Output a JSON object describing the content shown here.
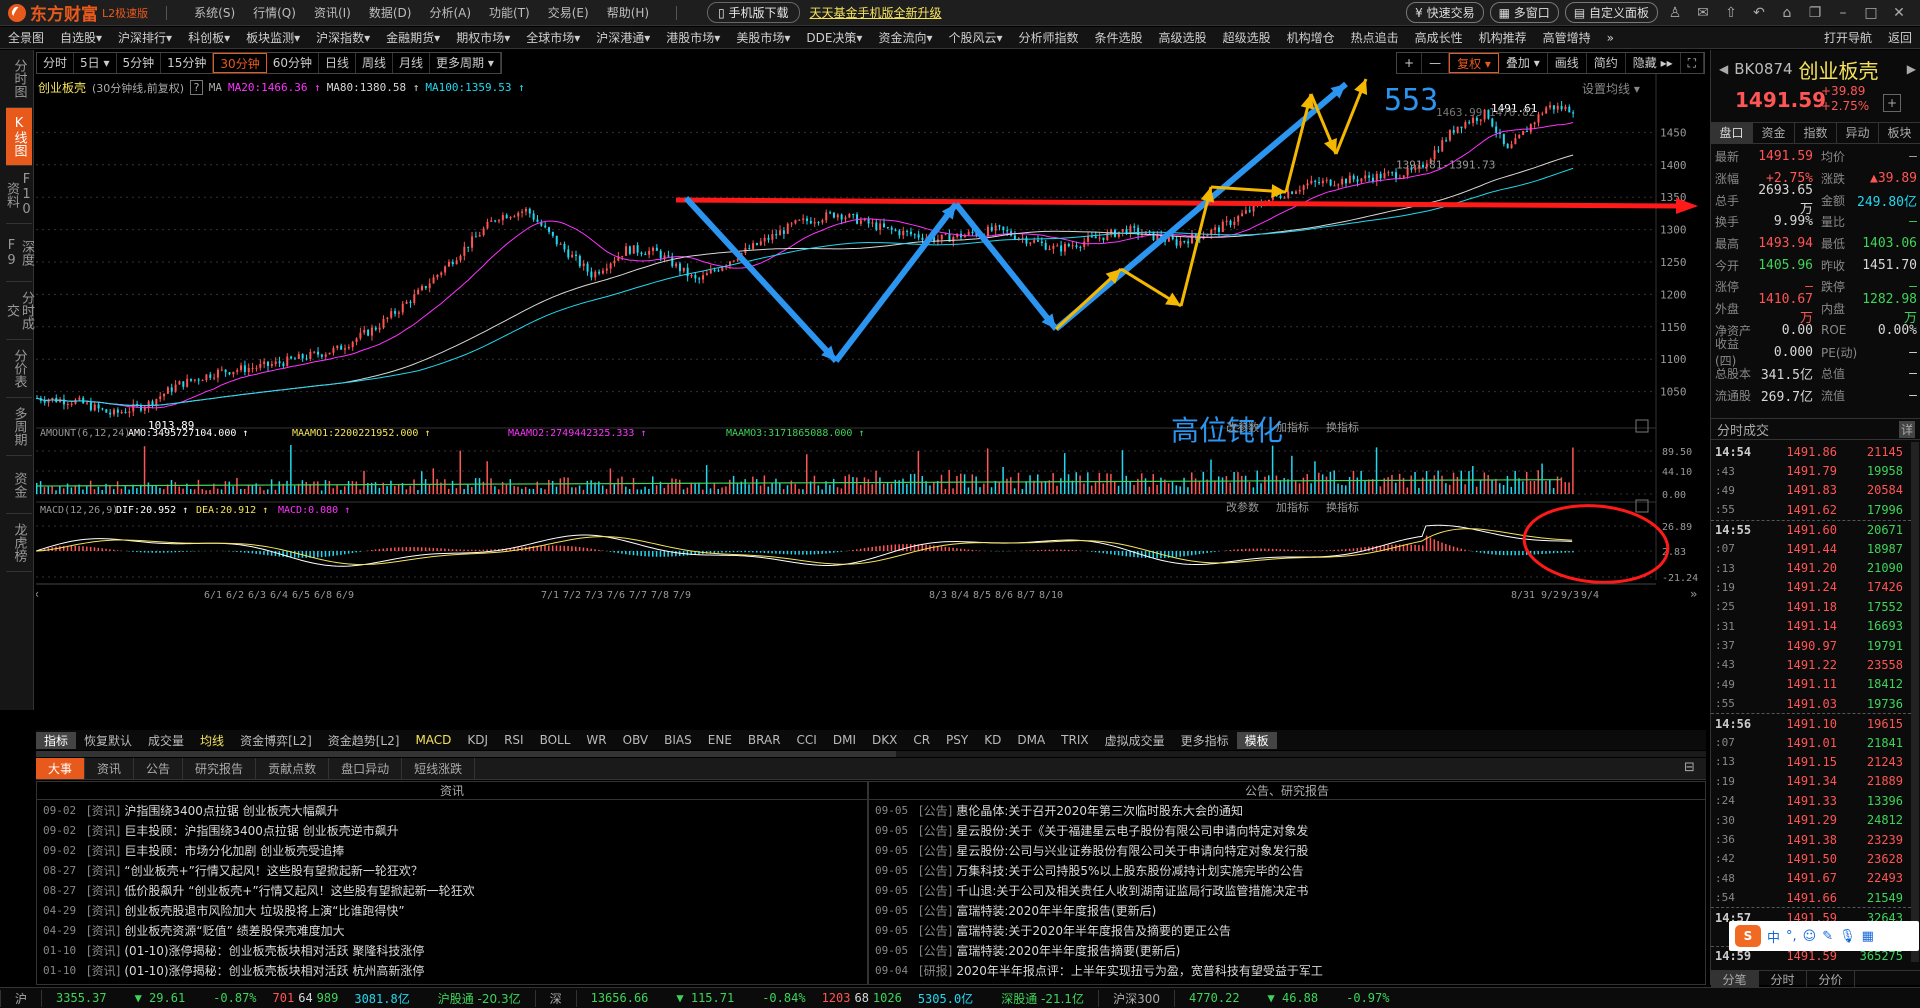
{
  "app": {
    "logo": "东方财富",
    "edition": "L2极速版"
  },
  "menu": [
    "系统(S)",
    "行情(Q)",
    "资讯(I)",
    "数据(D)",
    "分析(A)",
    "功能(T)",
    "交易(E)",
    "帮助(H)"
  ],
  "title_buttons": {
    "mobile_download": "手机版下载",
    "promo_link": "天天基金手机版全新升级",
    "quick_trade": "快速交易",
    "multi_window": "多窗口",
    "custom_panel": "自定义面板"
  },
  "nav": [
    "全景图",
    "自选股▾",
    "沪深排行▾",
    "科创板▾",
    "板块监测▾",
    "沪深指数▾",
    "金融期货▾",
    "期权市场▾",
    "全球市场▾",
    "沪深港通▾",
    "港股市场▾",
    "美股市场▾",
    "DDE决策▾",
    "资金流向▾",
    "个股风云▾",
    "分析师指数",
    "条件选股",
    "高级选股",
    "超级选股",
    "机构增仓",
    "热点追击",
    "高成长性",
    "机构推荐",
    "高管增持",
    "»"
  ],
  "nav_right": [
    "打开导航",
    "返回"
  ],
  "left_tabs": [
    {
      "label": "分时图",
      "active": false
    },
    {
      "label": "K线图",
      "active": true
    },
    {
      "label": "F10资料",
      "active": false
    },
    {
      "label": "深度F9",
      "active": false
    },
    {
      "label": "分时成交",
      "active": false
    },
    {
      "label": "分价表",
      "active": false
    },
    {
      "label": "多周期",
      "active": false
    },
    {
      "label": "资金",
      "active": false
    },
    {
      "label": "龙虎榜",
      "active": false
    }
  ],
  "periods": [
    {
      "label": "分时",
      "active": false
    },
    {
      "label": "5日 ▾",
      "active": false
    },
    {
      "label": "5分钟",
      "active": false
    },
    {
      "label": "15分钟",
      "active": false
    },
    {
      "label": "30分钟",
      "active": true
    },
    {
      "label": "60分钟",
      "active": false
    },
    {
      "label": "日线",
      "active": false
    },
    {
      "label": "周线",
      "active": false
    },
    {
      "label": "月线",
      "active": false
    },
    {
      "label": "更多周期 ▾",
      "active": false
    }
  ],
  "chart_tools": [
    {
      "label": "+",
      "active": false
    },
    {
      "label": "—",
      "active": false
    },
    {
      "label": "复权 ▾",
      "active": true
    },
    {
      "label": "叠加 ▾",
      "active": false
    },
    {
      "label": "画线",
      "active": false
    },
    {
      "label": "简约",
      "active": false
    },
    {
      "label": "隐藏 ▸▸",
      "active": false
    },
    {
      "label": "⛶",
      "active": false
    }
  ],
  "info": {
    "name": "创业板壳",
    "desc": "(30分钟线,前复权)",
    "ma_label": "MA",
    "ma20": "MA20:1466.36 ↑",
    "ma80": "MA80:1380.58 ↑",
    "ma100": "MA100:1359.53 ↑",
    "set_ma": "设置均线 ▾"
  },
  "chart_data": {
    "type": "candlestick",
    "title": "创业板壳 (30分钟线,前复权)",
    "price_axis": {
      "ticks": [
        1050,
        1100,
        1150,
        1200,
        1250,
        1300,
        1350,
        1400,
        1450
      ],
      "range": [
        1000,
        1500
      ]
    },
    "x_tick_labels": [
      "6/1",
      "6/2",
      "6/3",
      "6/4",
      "6/5",
      "6/8",
      "6/9",
      "7/1",
      "7/2",
      "7/3",
      "7/6",
      "7/7",
      "7/8",
      "7/9",
      "8/3",
      "8/4",
      "8/5",
      "8/6",
      "8/7",
      "8/10",
      "8/31",
      "9/2",
      "9/3",
      "9/4"
    ],
    "markers": {
      "low": "1013.89",
      "high_label": "1491.61",
      "range_label": "1391.81-1391.73",
      "mid_label": "1463.99 1470.82"
    },
    "annotations": [
      "553",
      "高位钝化"
    ],
    "volume": {
      "title": "AMOUNT(6,12,24)",
      "amo": "AMO:3495727104.000 ↑",
      "maamo1": "MAAMO1:2200221952.000 ↑",
      "maamo2": "MAAMO2:2749442325.333 ↑",
      "maamo3": "MAAMO3:3171865088.000 ↑",
      "axis": [
        "89.50",
        "44.10",
        "0.00"
      ]
    },
    "macd": {
      "title": "MACD(12,26,9)",
      "dif": "DIF:20.952 ↑",
      "dea": "DEA:20.912 ↑",
      "macd": "MACD:0.080 ↑",
      "axis": [
        "26.89",
        "2.83",
        "-21.24"
      ]
    },
    "panel_buttons": [
      "改参数",
      "加指标",
      "换指标"
    ]
  },
  "side": {
    "code": "BK0874",
    "name": "创业板壳",
    "price": "1491.59",
    "change": "+39.89",
    "change_pct": "+2.75%",
    "tabs": [
      "盘口",
      "资金",
      "指数",
      "异动",
      "板块"
    ],
    "quote": [
      {
        "l1": "最新",
        "v1": "1491.59",
        "c1": "red",
        "l2": "均价",
        "v2": "—",
        "c2": "grey"
      },
      {
        "l1": "涨幅",
        "v1": "+2.75%",
        "c1": "red",
        "l2": "涨跌",
        "v2": "▲39.89",
        "c2": "red"
      },
      {
        "l1": "总手",
        "v1": "2693.65万",
        "c1": "white",
        "l2": "金额",
        "v2": "249.80亿",
        "c2": "cyan"
      },
      {
        "l1": "换手",
        "v1": "9.99%",
        "c1": "white",
        "l2": "量比",
        "v2": "—",
        "c2": "green"
      },
      {
        "l1": "最高",
        "v1": "1493.94",
        "c1": "red",
        "l2": "最低",
        "v2": "1403.06",
        "c2": "green"
      },
      {
        "l1": "今开",
        "v1": "1405.96",
        "c1": "green",
        "l2": "昨收",
        "v2": "1451.70",
        "c2": "white"
      },
      {
        "l1": "涨停",
        "v1": "—",
        "c1": "red",
        "l2": "跌停",
        "v2": "—",
        "c2": "green"
      },
      {
        "l1": "外盘",
        "v1": "1410.67万",
        "c1": "red",
        "l2": "内盘",
        "v2": "1282.98万",
        "c2": "green"
      },
      {
        "l1": "净资产",
        "v1": "0.00",
        "c1": "white",
        "l2": "ROE",
        "v2": "0.00%",
        "c2": "white"
      },
      {
        "l1": "收益(四)",
        "v1": "0.000",
        "c1": "white",
        "l2": "PE(动)",
        "v2": "—",
        "c2": "white"
      },
      {
        "l1": "总股本",
        "v1": "341.5亿",
        "c1": "white",
        "l2": "总值",
        "v2": "—",
        "c2": "white"
      },
      {
        "l1": "流通股",
        "v1": "269.7亿",
        "c1": "white",
        "l2": "流值",
        "v2": "—",
        "c2": "white"
      }
    ],
    "ticks_title": "分时成交",
    "ticks_detail": "详",
    "ticks": [
      {
        "t": "14:54",
        "big": true,
        "p": "1491.86",
        "v": "21145",
        "vc": "red"
      },
      {
        "t": ":43",
        "p": "1491.79",
        "v": "19958",
        "vc": "green"
      },
      {
        "t": ":49",
        "p": "1491.83",
        "v": "20584",
        "vc": "red"
      },
      {
        "t": ":55",
        "p": "1491.62",
        "v": "17996",
        "vc": "green"
      },
      {
        "t": "14:55",
        "big": true,
        "p": "1491.60",
        "v": "20671",
        "vc": "green"
      },
      {
        "t": ":07",
        "p": "1491.44",
        "v": "18987",
        "vc": "green"
      },
      {
        "t": ":13",
        "p": "1491.20",
        "v": "21090",
        "vc": "green"
      },
      {
        "t": ":19",
        "p": "1491.24",
        "v": "17426",
        "vc": "red"
      },
      {
        "t": ":25",
        "p": "1491.18",
        "v": "17552",
        "vc": "green"
      },
      {
        "t": ":31",
        "p": "1491.14",
        "v": "16693",
        "vc": "green"
      },
      {
        "t": ":37",
        "p": "1490.97",
        "v": "19791",
        "vc": "green"
      },
      {
        "t": ":43",
        "p": "1491.22",
        "v": "23558",
        "vc": "red"
      },
      {
        "t": ":49",
        "p": "1491.11",
        "v": "18412",
        "vc": "green"
      },
      {
        "t": ":55",
        "p": "1491.03",
        "v": "19736",
        "vc": "green"
      },
      {
        "t": "14:56",
        "big": true,
        "p": "1491.10",
        "v": "19615",
        "vc": "red"
      },
      {
        "t": ":07",
        "p": "1491.01",
        "v": "21841",
        "vc": "green"
      },
      {
        "t": ":13",
        "p": "1491.15",
        "v": "21243",
        "vc": "red"
      },
      {
        "t": ":19",
        "p": "1491.34",
        "v": "21889",
        "vc": "red"
      },
      {
        "t": ":24",
        "p": "1491.33",
        "v": "13396",
        "vc": "green"
      },
      {
        "t": ":30",
        "p": "1491.29",
        "v": "24812",
        "vc": "green"
      },
      {
        "t": ":36",
        "p": "1491.38",
        "v": "23239",
        "vc": "red"
      },
      {
        "t": ":42",
        "p": "1491.50",
        "v": "23628",
        "vc": "red"
      },
      {
        "t": ":48",
        "p": "1491.67",
        "v": "22493",
        "vc": "red"
      },
      {
        "t": ":54",
        "p": "1491.66",
        "v": "21549",
        "vc": "green"
      },
      {
        "t": "14:57",
        "big": true,
        "p": "1491.59",
        "v": "32643",
        "vc": "green"
      },
      {
        "t": "",
        "p": "",
        "v": "",
        "vc": "green"
      },
      {
        "t": "14:59",
        "big": true,
        "p": "1491.59",
        "v": "365275",
        "vc": "green"
      }
    ],
    "bottom_tabs": [
      "分笔",
      "分时",
      "分价"
    ]
  },
  "ime": {
    "mode": "中",
    "punct": "°,"
  },
  "indicators": [
    {
      "label": "指标",
      "hl": true
    },
    {
      "label": "恢复默认"
    },
    {
      "label": "成交量"
    },
    {
      "label": "均线",
      "y": true
    },
    {
      "label": "资金博弈[L2]"
    },
    {
      "label": "资金趋势[L2]"
    },
    {
      "label": "MACD",
      "y": true
    },
    {
      "label": "KDJ"
    },
    {
      "label": "RSI"
    },
    {
      "label": "BOLL"
    },
    {
      "label": "WR"
    },
    {
      "label": "OBV"
    },
    {
      "label": "BIAS"
    },
    {
      "label": "ENE"
    },
    {
      "label": "BRAR"
    },
    {
      "label": "CCI"
    },
    {
      "label": "DMI"
    },
    {
      "label": "DKX"
    },
    {
      "label": "CR"
    },
    {
      "label": "PSY"
    },
    {
      "label": "KD"
    },
    {
      "label": "DMA"
    },
    {
      "label": "TRIX"
    },
    {
      "label": "虚拟成交量"
    },
    {
      "label": "更多指标"
    },
    {
      "label": "模板",
      "hl": true
    }
  ],
  "news_tabs": [
    {
      "label": "大事",
      "active": true
    },
    {
      "label": "资讯"
    },
    {
      "label": "公告"
    },
    {
      "label": "研究报告"
    },
    {
      "label": "贡献点数"
    },
    {
      "label": "盘口异动"
    },
    {
      "label": "短线涨跌"
    }
  ],
  "news_left": {
    "title": "资讯",
    "items": [
      {
        "date": "09-02",
        "tag": "[资讯]",
        "text": "沪指围绕3400点拉锯 创业板壳大幅飙升"
      },
      {
        "date": "09-02",
        "tag": "[资讯]",
        "text": "巨丰投顾：沪指围绕3400点拉锯 创业板壳逆市飙升"
      },
      {
        "date": "09-02",
        "tag": "[资讯]",
        "text": "巨丰投顾：市场分化加剧 创业板壳受追捧"
      },
      {
        "date": "08-27",
        "tag": "[资讯]",
        "text": "“创业板壳+”行情又起风！这些股有望掀起新一轮狂欢？"
      },
      {
        "date": "08-27",
        "tag": "[资讯]",
        "text": "低价股飙升 “创业板壳+”行情又起风！这些股有望掀起新一轮狂欢"
      },
      {
        "date": "04-29",
        "tag": "[资讯]",
        "text": "创业板壳股退市风险加大 垃圾股将上演“比谁跑得快”"
      },
      {
        "date": "04-29",
        "tag": "[资讯]",
        "text": "创业板壳资源“贬值” 绩差股保壳难度加大"
      },
      {
        "date": "01-10",
        "tag": "[资讯]",
        "text": "(01-10)涨停揭秘：创业板壳板块相对活跃 聚隆科技涨停"
      },
      {
        "date": "01-10",
        "tag": "[资讯]",
        "text": "(01-10)涨停揭秘：创业板壳板块相对活跃 杭州高新涨停"
      }
    ]
  },
  "news_right": {
    "title": "公告、研究报告",
    "items": [
      {
        "date": "09-05",
        "tag": "[公告]",
        "text": "惠伦晶体:关于召开2020年第三次临时股东大会的通知"
      },
      {
        "date": "09-05",
        "tag": "[公告]",
        "text": "星云股份:关于《关于福建星云电子股份有限公司申请向特定对象发"
      },
      {
        "date": "09-05",
        "tag": "[公告]",
        "text": "星云股份:公司与兴业证券股份有限公司关于申请向特定对象发行股"
      },
      {
        "date": "09-05",
        "tag": "[公告]",
        "text": "万集科技:关于公司持股5%以上股东股份减持计划实施完毕的公告"
      },
      {
        "date": "09-05",
        "tag": "[公告]",
        "text": "千山退:关于公司及相关责任人收到湖南证监局行政监管措施决定书"
      },
      {
        "date": "09-05",
        "tag": "[公告]",
        "text": "富瑞特装:2020年半年度报告(更新后)"
      },
      {
        "date": "09-05",
        "tag": "[公告]",
        "text": "富瑞特装:关于2020年半年度报告及摘要的更正公告"
      },
      {
        "date": "09-05",
        "tag": "[公告]",
        "text": "富瑞特装:2020年半年度报告摘要(更新后)"
      },
      {
        "date": "09-04",
        "tag": "[研报]",
        "text": "2020年半年报点评：上半年实现扭亏为盈，宽普科技有望受益于军工"
      }
    ]
  },
  "status": {
    "sh_label": "沪",
    "sh_index": "3355.37",
    "sh_chg": "▼ 29.61",
    "sh_pct": "-0.87%",
    "sh_up": "701",
    "sh_flat": "64",
    "sh_down": "989",
    "sh_amt": "3081.8亿",
    "hgt": "沪股通 -20.3亿",
    "sz_label": "深",
    "sz_index": "13656.66",
    "sz_chg": "▼ 115.71",
    "sz_pct": "-0.84%",
    "sz_up": "1203",
    "sz_flat": "68",
    "sz_down": "1026",
    "sz_amt": "5305.0亿",
    "sgt": "深股通 -21.1亿",
    "hs300_label": "沪深300",
    "hs300": "4770.22",
    "hs300_chg": "▼ 46.88",
    "hs300_pct": "-0.97%"
  }
}
